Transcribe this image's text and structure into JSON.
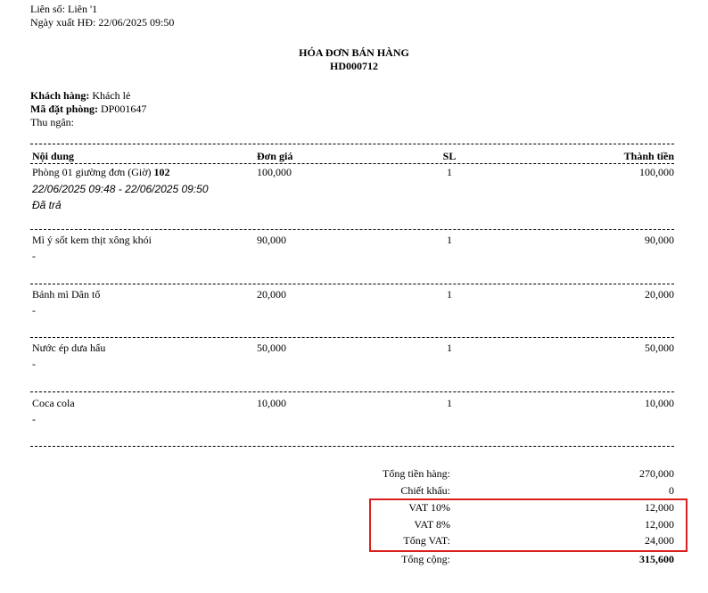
{
  "meta": {
    "copy_label": "Liên số: Liên '1",
    "export_date_label": "Ngày xuất HĐ:",
    "export_date": "22/06/2025 09:50"
  },
  "title": "HÓA ĐƠN BÁN HÀNG",
  "invoice_no": "HD000712",
  "customer": {
    "customer_label": "Khách hàng:",
    "customer_value": "Khách lẻ",
    "booking_label": "Mã đặt phòng:",
    "booking_value": "DP001647",
    "cashier_label": "Thu ngân:"
  },
  "table": {
    "headers": [
      "Nội dung",
      "Đơn giá",
      "SL",
      "Thành tiền"
    ],
    "rows": [
      {
        "name": "Phòng 01 giường đơn (Giờ)",
        "name_bold": "102",
        "price": "100,000",
        "qty": "1",
        "total": "100,000",
        "line2": "22/06/2025 09:48 - 22/06/2025 09:50",
        "line3": "Đã trả"
      },
      {
        "name": "Mì ý sốt kem thịt xông khói",
        "price": "90,000",
        "qty": "1",
        "total": "90,000",
        "line2": "-"
      },
      {
        "name": "Bánh mì Dân tổ",
        "price": "20,000",
        "qty": "1",
        "total": "20,000",
        "line2": "-"
      },
      {
        "name": "Nước ép dưa hấu",
        "price": "50,000",
        "qty": "1",
        "total": "50,000",
        "line2": "-"
      },
      {
        "name": "Coca cola",
        "price": "10,000",
        "qty": "1",
        "total": "10,000",
        "line2": "-"
      }
    ]
  },
  "summary": [
    {
      "label": "Tổng tiền hàng:",
      "value": "270,000"
    },
    {
      "label": "Chiết khấu:",
      "value": "0"
    },
    {
      "label": "VAT 10%",
      "value": "12,000"
    },
    {
      "label": "VAT 8%",
      "value": "12,000"
    },
    {
      "label": "Tổng VAT:",
      "value": "24,000"
    },
    {
      "label": "Tổng cộng:",
      "value": "315,600"
    }
  ],
  "colors": {
    "highlight_border": "#d9201f"
  }
}
